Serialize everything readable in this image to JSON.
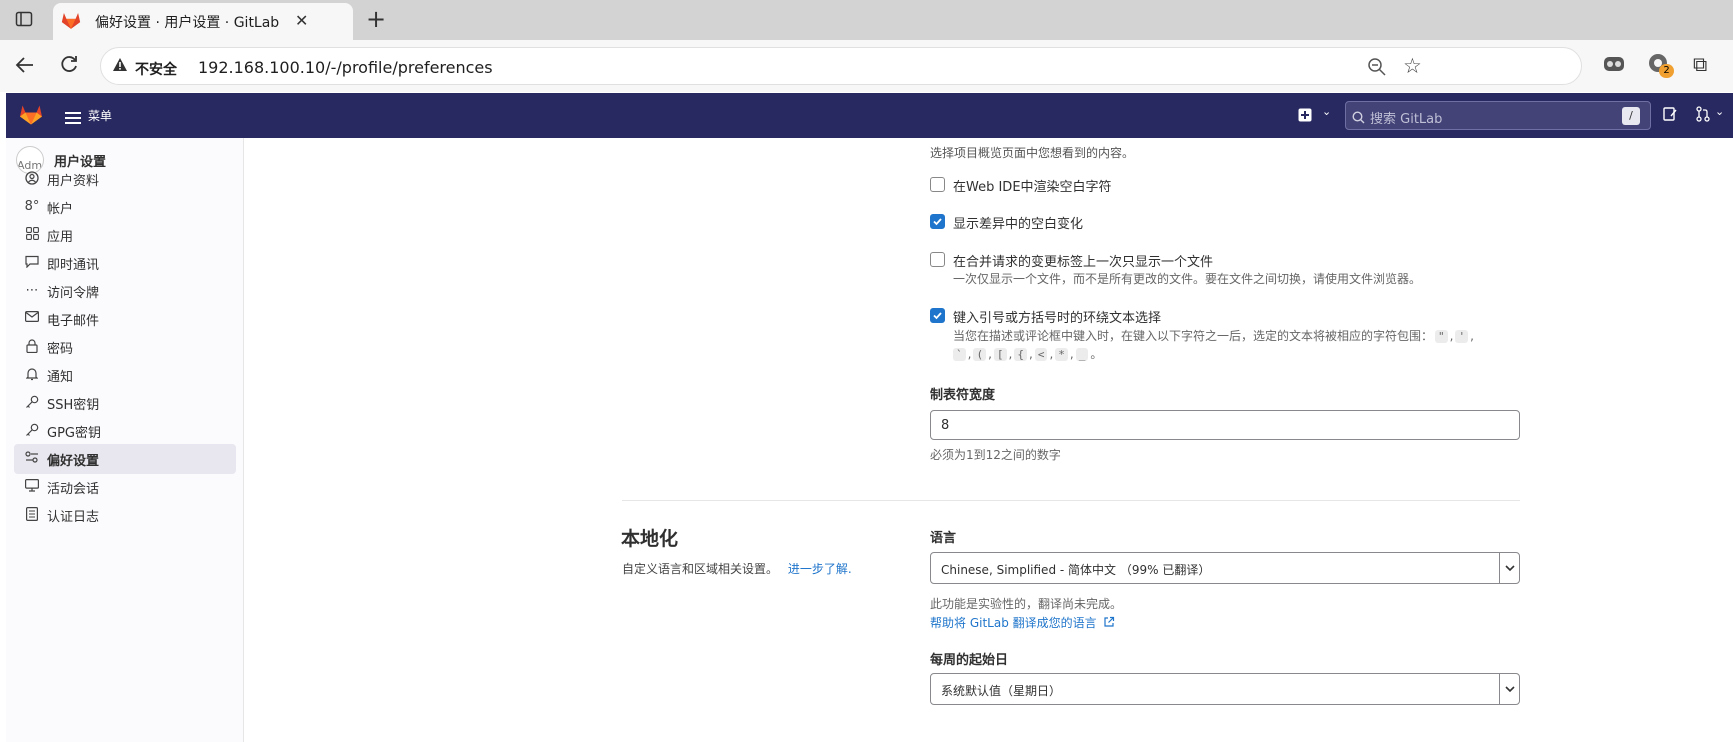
{
  "browser": {
    "tab_title": "偏好设置 · 用户设置 · GitLab",
    "security_label": "不安全",
    "url": "192.168.100.10/-/profile/preferences",
    "extension_badge": "2"
  },
  "header": {
    "menu_label": "菜单",
    "search_placeholder": "搜索 GitLab",
    "search_shortcut": "/"
  },
  "sidebar": {
    "title": "用户设置",
    "avatar_alt": "Adm",
    "items": [
      {
        "label": "用户资料",
        "icon": "user-icon"
      },
      {
        "label": "帐户",
        "icon": "account-icon"
      },
      {
        "label": "应用",
        "icon": "applications-icon"
      },
      {
        "label": "即时通讯",
        "icon": "chat-icon"
      },
      {
        "label": "访问令牌",
        "icon": "token-icon"
      },
      {
        "label": "电子邮件",
        "icon": "mail-icon"
      },
      {
        "label": "密码",
        "icon": "lock-icon"
      },
      {
        "label": "通知",
        "icon": "notifications-icon"
      },
      {
        "label": "SSH密钥",
        "icon": "key-icon"
      },
      {
        "label": "GPG密钥",
        "icon": "key-icon"
      },
      {
        "label": "偏好设置",
        "icon": "preferences-icon",
        "active": true
      },
      {
        "label": "活动会话",
        "icon": "monitor-icon"
      },
      {
        "label": "认证日志",
        "icon": "log-icon"
      }
    ]
  },
  "behavior": {
    "overview_help": "选择项目概览页面中您想看到的内容。",
    "render_whitespace": {
      "label": "在Web IDE中渲染空白字符",
      "checked": false
    },
    "show_whitespace_diff": {
      "label": "显示差异中的空白变化",
      "checked": true
    },
    "one_file_at_a_time": {
      "label": "在合并请求的变更标签上一次只显示一个文件",
      "help": "一次仅显示一个文件，而不是所有更改的文件。要在文件之间切换，请使用文件浏览器。",
      "checked": false
    },
    "surround_selection": {
      "label": "键入引号或方括号时的环绕文本选择",
      "help": "当您在描述或评论框中键入时，在键入以下字符之一后，选定的文本将被相应的字符包围：",
      "chars_line1": [
        "\"",
        "'"
      ],
      "chars_line2": [
        "`",
        "(",
        "[",
        "{",
        "<",
        "*",
        "_"
      ],
      "checked": true
    },
    "tab_width": {
      "label": "制表符宽度",
      "value": "8",
      "help": "必须为1到12之间的数字"
    }
  },
  "localization": {
    "title": "本地化",
    "description": "自定义语言和区域相关设置。",
    "learn_more": "进一步了解.",
    "language": {
      "label": "语言",
      "value": "Chinese, Simplified - 简体中文 （99% 已翻译）",
      "note": "此功能是实验性的，翻译尚未完成。",
      "help_link": "帮助将 GitLab 翻译成您的语言"
    },
    "first_day": {
      "label": "每周的起始日",
      "value": "系统默认值（星期日）"
    }
  },
  "colors": {
    "header": "#292961",
    "primary": "#1f75cb",
    "gitlab_orange": "#fc6d26"
  }
}
